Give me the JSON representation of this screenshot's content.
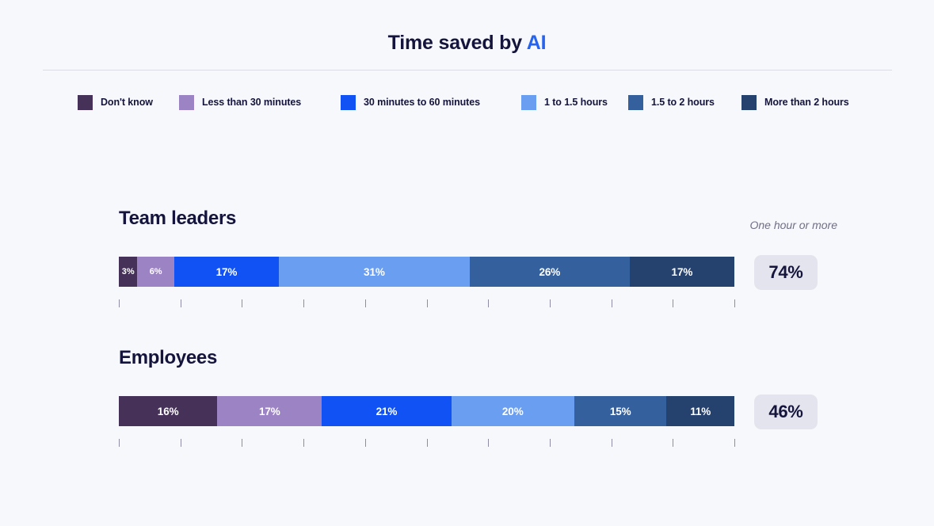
{
  "header": {
    "title_main": "Time saved by ",
    "title_accent": "AI",
    "accent_color": "#2563f0"
  },
  "legend": {
    "items": [
      {
        "label": "Don't know",
        "color": "#463259"
      },
      {
        "label": "Less than 30 minutes",
        "color": "#9b83c4"
      },
      {
        "label": "30 minutes to 60 minutes",
        "color": "#1152f5"
      },
      {
        "label": "1 to 1.5 hours",
        "color": "#6a9ef0"
      },
      {
        "label": "1.5 to 2 hours",
        "color": "#34609e"
      },
      {
        "label": "More than 2 hours",
        "color": "#25416e"
      }
    ]
  },
  "groups": [
    {
      "title": "Team leaders",
      "note": "One hour or more",
      "total_label": "74%",
      "segment_labels": [
        "3%",
        "6%",
        "17%",
        "31%",
        "26%",
        "17%"
      ]
    },
    {
      "title": "Employees",
      "note": "",
      "total_label": "46%",
      "segment_labels": [
        "16%",
        "17%",
        "21%",
        "20%",
        "15%",
        "11%"
      ]
    }
  ],
  "chart_data": {
    "type": "bar",
    "orientation": "horizontal",
    "stacked": true,
    "normalized_percent": true,
    "title": "Time saved by AI",
    "xlabel": "",
    "ylabel": "",
    "xlim": [
      0,
      100
    ],
    "grid": false,
    "ticks": [
      0,
      10,
      20,
      30,
      40,
      50,
      60,
      70,
      80,
      90,
      100
    ],
    "tick_labels_visible": false,
    "legend_position": "top",
    "categories": [
      "Team leaders",
      "Employees"
    ],
    "series": [
      {
        "name": "Don't know",
        "color": "#463259",
        "values": [
          3,
          16
        ]
      },
      {
        "name": "Less than 30 minutes",
        "color": "#9b83c4",
        "values": [
          6,
          17
        ]
      },
      {
        "name": "30 minutes to 60 minutes",
        "color": "#1152f5",
        "values": [
          17,
          21
        ]
      },
      {
        "name": "1 to 1.5 hours",
        "color": "#6a9ef0",
        "values": [
          31,
          20
        ]
      },
      {
        "name": "1.5 to 2 hours",
        "color": "#34609e",
        "values": [
          26,
          15
        ]
      },
      {
        "name": "More than 2 hours",
        "color": "#25416e",
        "values": [
          17,
          11
        ]
      }
    ],
    "annotations": [
      {
        "text": "One hour or more",
        "target": "totals-column"
      },
      {
        "category": "Team leaders",
        "label": "74%",
        "meaning": "one hour or more"
      },
      {
        "category": "Employees",
        "label": "46%",
        "meaning": "one hour or more"
      }
    ]
  }
}
